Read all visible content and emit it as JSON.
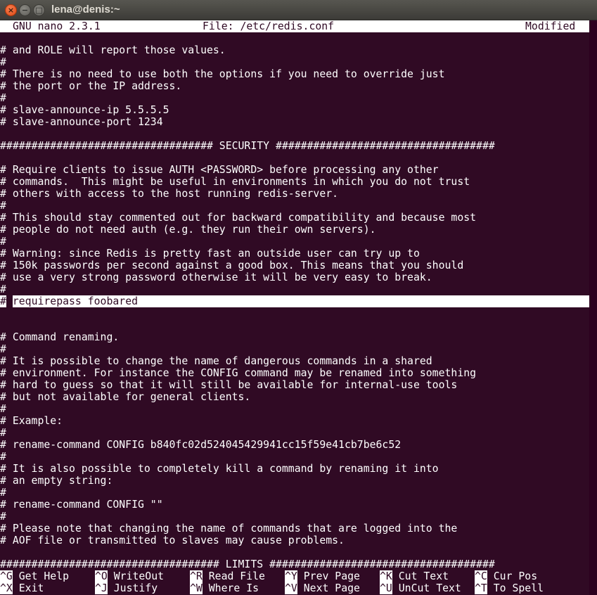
{
  "window": {
    "title": "lena@denis:~",
    "buttons": {
      "close": "×",
      "minimize": "−",
      "maximize": "□"
    }
  },
  "header": {
    "version": "GNU nano 2.3.1",
    "file": "File: /etc/redis.conf",
    "status": "Modified"
  },
  "editor": {
    "lines": [
      "# and ROLE will report those values.",
      "#",
      "# There is no need to use both the options if you need to override just",
      "# the port or the IP address.",
      "#",
      "# slave-announce-ip 5.5.5.5",
      "# slave-announce-port 1234",
      "",
      "################################## SECURITY ###################################",
      "",
      "# Require clients to issue AUTH <PASSWORD> before processing any other",
      "# commands.  This might be useful in environments in which you do not trust",
      "# others with access to the host running redis-server.",
      "#",
      "# This should stay commented out for backward compatibility and because most",
      "# people do not need auth (e.g. they run their own servers).",
      "#",
      "# Warning: since Redis is pretty fast an outside user can try up to",
      "# 150k passwords per second against a good box. This means that you should",
      "# use a very strong password otherwise it will be very easy to break.",
      "#",
      "",
      "",
      "# Command renaming.",
      "#",
      "# It is possible to change the name of dangerous commands in a shared",
      "# environment. For instance the CONFIG command may be renamed into something",
      "# hard to guess so that it will still be available for internal-use tools",
      "# but not available for general clients.",
      "#",
      "# Example:",
      "#",
      "# rename-command CONFIG b840fc02d524045429941cc15f59e41cb7be6c52",
      "#",
      "# It is also possible to completely kill a command by renaming it into",
      "# an empty string:",
      "#",
      "# rename-command CONFIG \"\"",
      "#",
      "# Please note that changing the name of commands that are logged into the",
      "# AOF file or transmitted to slaves may cause problems.",
      "",
      "################################### LIMITS ####################################"
    ],
    "current_line": {
      "prefix": "#",
      "cursor_char": " ",
      "rest": "requirepass foobared"
    }
  },
  "shortcuts": [
    {
      "key": "^G",
      "label": "Get Help"
    },
    {
      "key": "^O",
      "label": "WriteOut"
    },
    {
      "key": "^R",
      "label": "Read File"
    },
    {
      "key": "^Y",
      "label": "Prev Page"
    },
    {
      "key": "^K",
      "label": "Cut Text"
    },
    {
      "key": "^C",
      "label": "Cur Pos"
    },
    {
      "key": "^X",
      "label": "Exit"
    },
    {
      "key": "^J",
      "label": "Justify"
    },
    {
      "key": "^W",
      "label": "Where Is"
    },
    {
      "key": "^V",
      "label": "Next Page"
    },
    {
      "key": "^U",
      "label": "UnCut Text"
    },
    {
      "key": "^T",
      "label": "To Spell"
    }
  ],
  "colors": {
    "terminal_bg": "#300a24",
    "terminal_fg": "#ffffff",
    "close_button": "#df4a16"
  }
}
